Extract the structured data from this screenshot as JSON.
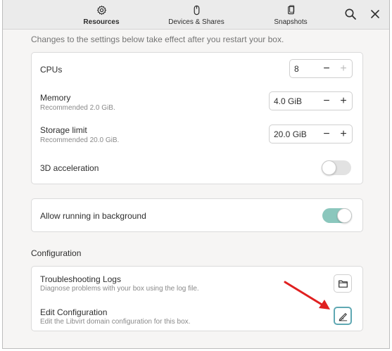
{
  "header": {
    "tabs": [
      {
        "label": "Resources",
        "icon": "gear-icon",
        "active": true
      },
      {
        "label": "Devices & Shares",
        "icon": "mouse-icon",
        "active": false
      },
      {
        "label": "Snapshots",
        "icon": "snapshot-icon",
        "active": false
      }
    ],
    "search_icon": "search-icon",
    "close_icon": "close-icon"
  },
  "intro": "Changes to the settings below take effect after you restart your box.",
  "resources": {
    "cpus": {
      "title": "CPUs",
      "value": "8"
    },
    "memory": {
      "title": "Memory",
      "subtitle": "Recommended 2.0 GiB.",
      "value": "4.0 GiB"
    },
    "storage": {
      "title": "Storage limit",
      "subtitle": "Recommended 20.0 GiB.",
      "value": "20.0 GiB"
    },
    "acceleration": {
      "title": "3D acceleration",
      "enabled": false
    }
  },
  "background": {
    "title": "Allow running in background",
    "enabled": true
  },
  "configuration": {
    "section_title": "Configuration",
    "logs": {
      "title": "Troubleshooting Logs",
      "subtitle": "Diagnose problems with your box using the log file."
    },
    "edit": {
      "title": "Edit Configuration",
      "subtitle": "Edit the Libvirt domain configuration for this box."
    }
  },
  "spin_labels": {
    "minus": "−",
    "plus": "+"
  },
  "colors": {
    "accent": "#8bc7bd",
    "annotation_arrow": "#e02020",
    "focus_ring": "#5fa8b3"
  }
}
